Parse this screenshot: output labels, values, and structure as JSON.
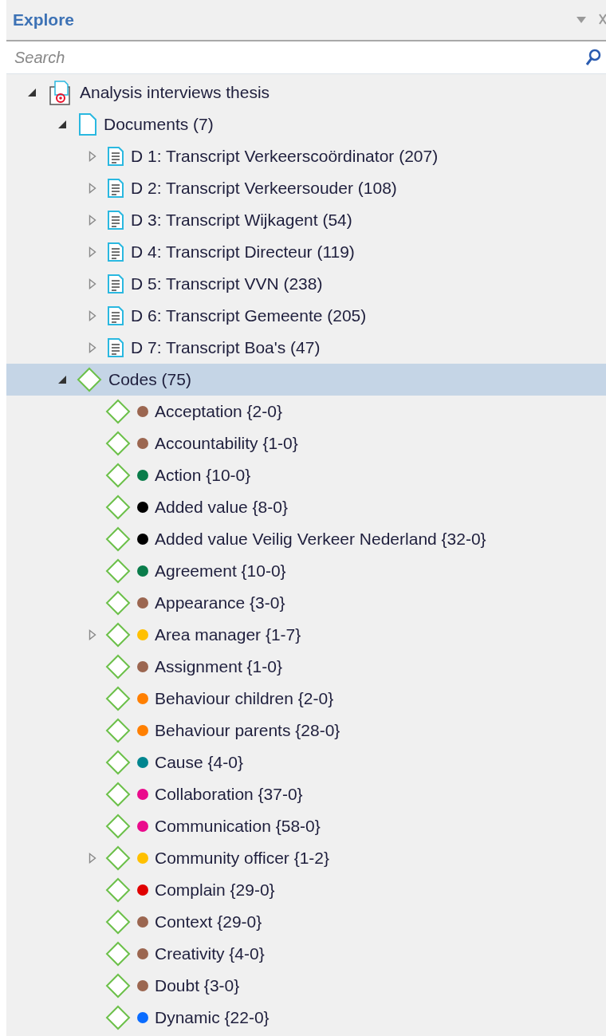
{
  "panel": {
    "title": "Explore"
  },
  "search": {
    "placeholder": "Search"
  },
  "tree": [
    {
      "label": "Analysis interviews thesis",
      "kind": "project",
      "expanded": true,
      "selected": false,
      "children": [
        {
          "label": "Documents (7)",
          "kind": "folder",
          "expanded": true,
          "selected": false,
          "children": [
            {
              "label": "D 1: Transcript Verkeerscoördinator (207)",
              "kind": "document",
              "expanded": false,
              "selected": false
            },
            {
              "label": "D 2: Transcript Verkeersouder (108)",
              "kind": "document",
              "expanded": false,
              "selected": false
            },
            {
              "label": "D 3: Transcript Wijkagent (54)",
              "kind": "document",
              "expanded": false,
              "selected": false
            },
            {
              "label": "D 4: Transcript Directeur (119)",
              "kind": "document",
              "expanded": false,
              "selected": false
            },
            {
              "label": "D 5: Transcript VVN (238)",
              "kind": "document",
              "expanded": false,
              "selected": false
            },
            {
              "label": "D 6: Transcript Gemeente (205)",
              "kind": "document",
              "expanded": false,
              "selected": false
            },
            {
              "label": "D 7: Transcript Boa's (47)",
              "kind": "document",
              "expanded": false,
              "selected": false
            }
          ]
        },
        {
          "label": "Codes (75)",
          "kind": "codes",
          "expanded": true,
          "selected": true,
          "children": [
            {
              "label": "Acceptation {2-0}",
              "kind": "code",
              "color": "#9b6650",
              "selected": false
            },
            {
              "label": "Accountability {1-0}",
              "kind": "code",
              "color": "#9b6650",
              "selected": false
            },
            {
              "label": "Action {10-0}",
              "kind": "code",
              "color": "#0a7c4a",
              "selected": false
            },
            {
              "label": "Added value {8-0}",
              "kind": "code",
              "color": "#000000",
              "selected": false
            },
            {
              "label": "Added value Veilig Verkeer Nederland {32-0}",
              "kind": "code",
              "color": "#000000",
              "selected": false
            },
            {
              "label": "Agreement {10-0}",
              "kind": "code",
              "color": "#0a7c4a",
              "selected": false
            },
            {
              "label": "Appearance {3-0}",
              "kind": "code",
              "color": "#9b6650",
              "selected": false
            },
            {
              "label": "Area manager {1-7}",
              "kind": "code",
              "color": "#ffc000",
              "expanded": false,
              "selected": false
            },
            {
              "label": "Assignment {1-0}",
              "kind": "code",
              "color": "#9b6650",
              "selected": false
            },
            {
              "label": "Behaviour children {2-0}",
              "kind": "code",
              "color": "#ff7f00",
              "selected": false
            },
            {
              "label": "Behaviour parents {28-0}",
              "kind": "code",
              "color": "#ff7f00",
              "selected": false
            },
            {
              "label": "Cause {4-0}",
              "kind": "code",
              "color": "#00858f",
              "selected": false
            },
            {
              "label": "Collaboration {37-0}",
              "kind": "code",
              "color": "#ea0a8c",
              "selected": false
            },
            {
              "label": "Communication {58-0}",
              "kind": "code",
              "color": "#ea0a8c",
              "selected": false
            },
            {
              "label": "Community officer {1-2}",
              "kind": "code",
              "color": "#ffc000",
              "expanded": false,
              "selected": false
            },
            {
              "label": "Complain {29-0}",
              "kind": "code",
              "color": "#e00000",
              "selected": false
            },
            {
              "label": "Context {29-0}",
              "kind": "code",
              "color": "#9b6650",
              "selected": false
            },
            {
              "label": "Creativity {4-0}",
              "kind": "code",
              "color": "#9b6650",
              "selected": false
            },
            {
              "label": "Doubt {3-0}",
              "kind": "code",
              "color": "#9b6650",
              "selected": false
            },
            {
              "label": "Dynamic {22-0}",
              "kind": "code",
              "color": "#0a6cff",
              "selected": false
            }
          ]
        }
      ]
    }
  ]
}
